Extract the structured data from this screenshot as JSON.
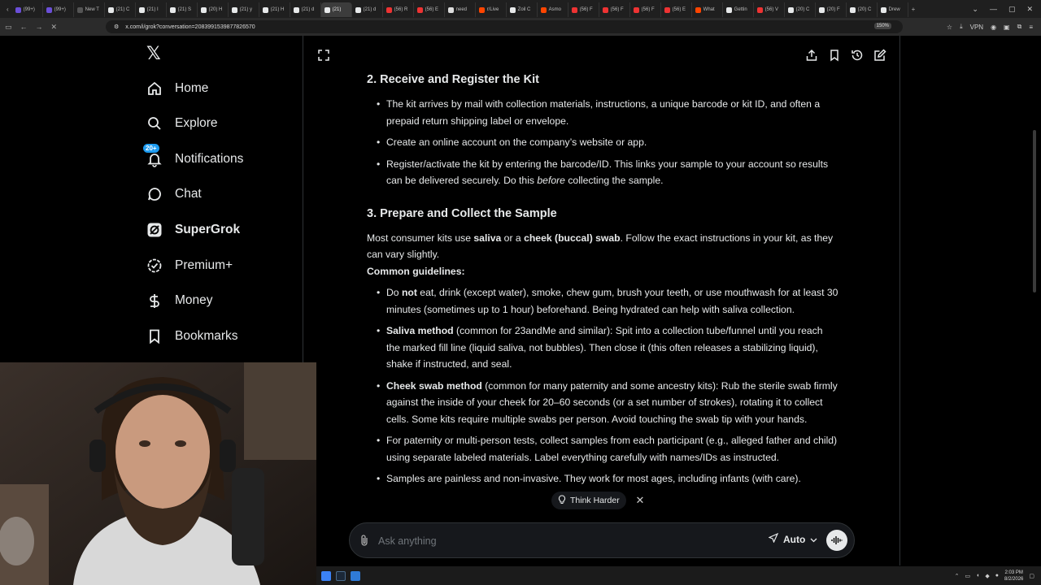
{
  "browser": {
    "tabs": [
      "(99+)",
      "(99+)",
      "New T",
      "(21) C",
      "(21) I",
      "(21) S",
      "(20) H",
      "(21) y",
      "(21) H",
      "(21) d",
      "(21)",
      "(21) d",
      "(56) R",
      "(56) E",
      "need",
      "r/Live",
      "Zoil C",
      "Asmo",
      "(56) F",
      "(56) F",
      "(56) F",
      "(56) E",
      "What",
      "Gettin",
      "(56) V",
      "(20) C",
      "(20) F",
      "(20) C",
      "Drew"
    ],
    "url": "x.com/i/grok?conversation=2083991539877826570",
    "zoom": "150%",
    "vpn": "VPN"
  },
  "sidebar": {
    "items": [
      {
        "label": "Home",
        "icon": "home-icon"
      },
      {
        "label": "Explore",
        "icon": "search-icon"
      },
      {
        "label": "Notifications",
        "icon": "bell-icon",
        "badge": "20+"
      },
      {
        "label": "Chat",
        "icon": "chat-icon"
      },
      {
        "label": "SuperGrok",
        "icon": "grok-icon"
      },
      {
        "label": "Premium+",
        "icon": "verified-icon"
      },
      {
        "label": "Money",
        "icon": "dollar-icon"
      },
      {
        "label": "Bookmarks",
        "icon": "bookmark-icon"
      }
    ]
  },
  "content": {
    "section2_title": "2. Receive and Register the Kit",
    "s2_b1": "The kit arrives by mail with collection materials, instructions, a unique barcode or kit ID, and often a prepaid return shipping label or envelope.",
    "s2_b2": "Create an online account on the company’s website or app.",
    "s2_b3_pre": "Register/activate the kit by entering the barcode/ID. This links your sample to your account so results can be delivered securely. Do this ",
    "s2_b3_em": "before",
    "s2_b3_post": " collecting the sample.",
    "section3_title": "3. Prepare and Collect the Sample",
    "s3_intro_1": "Most consumer kits use ",
    "s3_intro_saliva": "saliva",
    "s3_intro_2": " or a ",
    "s3_intro_cheek": "cheek (buccal) swab",
    "s3_intro_3": ". Follow the exact instructions in your kit, as they can vary slightly.",
    "guidelines_label": "Common guidelines:",
    "g1_pre": "Do ",
    "g1_not": "not",
    "g1_post": " eat, drink (except water), smoke, chew gum, brush your teeth, or use mouthwash for at least 30 minutes (sometimes up to 1 hour) beforehand. Being hydrated can help with saliva collection.",
    "g2_bold": "Saliva method",
    "g2_text": " (common for 23andMe and similar): Spit into a collection tube/funnel until you reach the marked fill line (liquid saliva, not bubbles). Then close it (this often releases a stabilizing liquid), shake if instructed, and seal.",
    "g3_bold": "Cheek swab method",
    "g3_text": " (common for many paternity and some ancestry kits): Rub the sterile swab firmly against the inside of your cheek for 20–60 seconds (or a set number of strokes), rotating it to collect cells. Some kits require multiple swabs per person. Avoid touching the swab tip with your hands.",
    "g4": "For paternity or multi-person tests, collect samples from each participant (e.g., alleged father and child) using separate labeled materials. Label everything carefully with names/IDs as instructed.",
    "g5": "Samples are painless and non-invasive. They work for most ages, including infants (with care)."
  },
  "composer": {
    "think_label": "Think Harder",
    "placeholder": "Ask anything",
    "mode": "Auto"
  },
  "taskbar": {
    "time": "2:03 PM",
    "date": "8/2/2026"
  }
}
